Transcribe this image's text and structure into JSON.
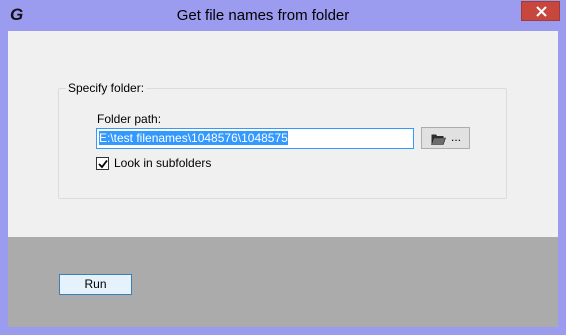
{
  "window": {
    "title": "Get file names from folder",
    "app_icon_letter": "G",
    "colors": {
      "frame": "#9b9bef",
      "close": "#c7463e",
      "client": "#f0f0f0",
      "footer": "#ababab",
      "selection": "#3399ff"
    }
  },
  "group": {
    "legend": "Specify folder:",
    "folder_label": "Folder path:",
    "path_value": "E:\\test filenames\\1048576\\1048575",
    "browse_label": "...",
    "browse_icon": "folder-open-icon",
    "subfolders_label": "Look in subfolders",
    "subfolders_checked": true
  },
  "footer": {
    "run_label": "Run"
  }
}
